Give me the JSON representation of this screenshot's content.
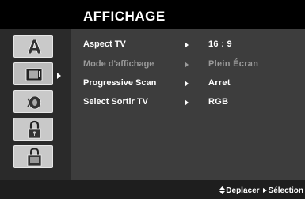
{
  "menu": {
    "title": "AFFICHAGE"
  },
  "sidebar": {
    "tabs": [
      {
        "icon": "language-icon",
        "active": false
      },
      {
        "icon": "display-icon",
        "active": true
      },
      {
        "icon": "audio-icon",
        "active": false
      },
      {
        "icon": "lock-icon",
        "active": false
      },
      {
        "icon": "others-icon",
        "active": false
      }
    ]
  },
  "settings": [
    {
      "label": "Aspect TV",
      "value": "16 : 9",
      "enabled": true
    },
    {
      "label": "Mode d'affichage",
      "value": "Plein Écran",
      "enabled": false
    },
    {
      "label": "Progressive Scan",
      "value": "Arret",
      "enabled": true
    },
    {
      "label": "Select Sortir TV",
      "value": "RGB",
      "enabled": true
    }
  ],
  "footer": {
    "move_label": "Deplacer",
    "select_label": "Sélection"
  }
}
